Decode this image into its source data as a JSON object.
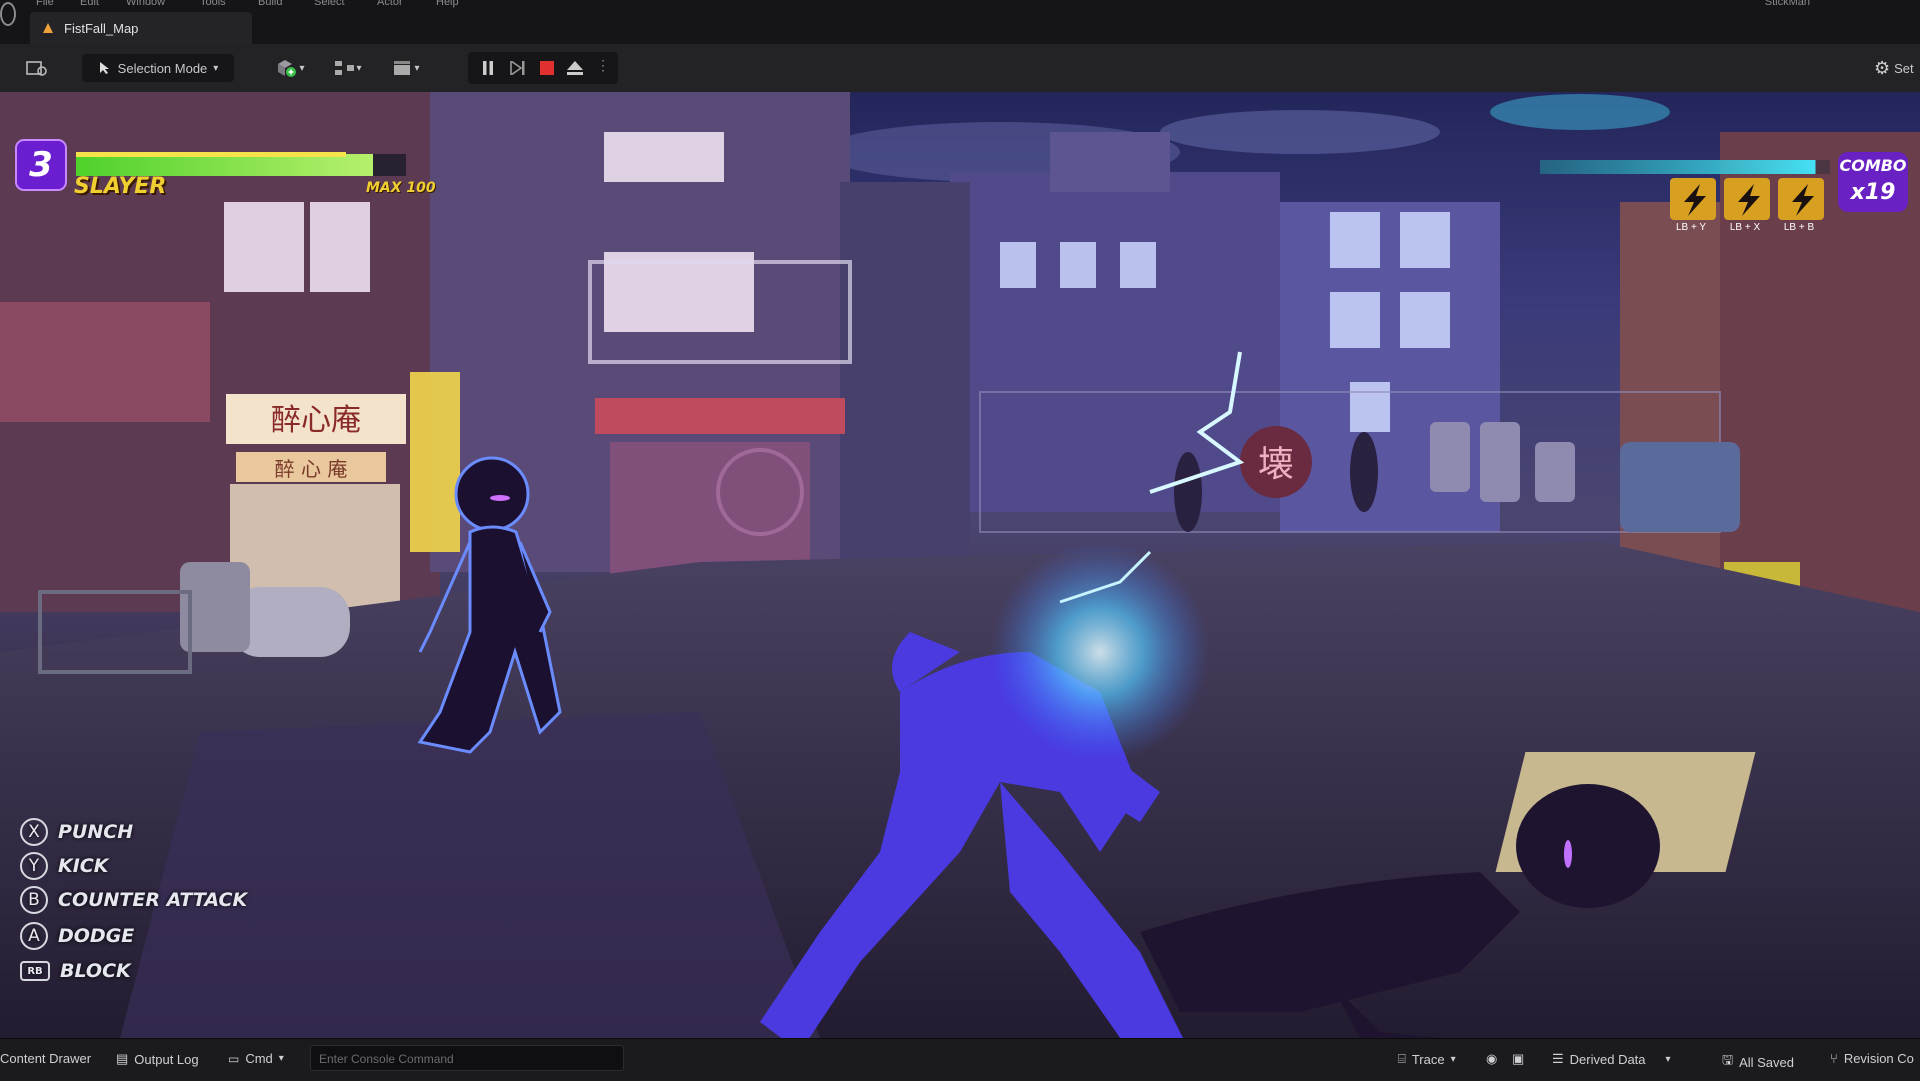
{
  "menubar": {
    "items": [
      "File",
      "Edit",
      "Window",
      "Tools",
      "Build",
      "Select",
      "Actor",
      "Help"
    ],
    "user": "StickMan"
  },
  "tab": {
    "label": "FistFall_Map",
    "icon": "level-icon"
  },
  "toolbar": {
    "selection_mode": "Selection Mode",
    "settings_label": "Set"
  },
  "hud": {
    "player_level": "3",
    "player_name": "SLAYER",
    "max_label": "MAX 100",
    "player_health": 0.9,
    "enemy_health": 0.95,
    "combo_label": "COMBO",
    "combo_count": "x19",
    "controls": [
      {
        "key": "X",
        "action": "PUNCH"
      },
      {
        "key": "Y",
        "action": "KICK"
      },
      {
        "key": "B",
        "action": "COUNTER ATTACK"
      },
      {
        "key": "A",
        "action": "DODGE"
      },
      {
        "key": "RB",
        "action": "BLOCK"
      }
    ],
    "special_combos": [
      "LB + Y",
      "LB + X",
      "LB + B"
    ],
    "shop_sign": "醉心庵",
    "shop_sign_small": "醉 心 庵",
    "shutter_sign": "壊",
    "colors": {
      "health": "#7be03c",
      "enemy_health": "#36c6e8",
      "accent": "#7a28d8"
    }
  },
  "statusbar": {
    "content_drawer": "Content Drawer",
    "output_log": "Output Log",
    "cmd": "Cmd",
    "console_placeholder": "Enter Console Command",
    "trace": "Trace",
    "derived_data": "Derived Data",
    "all_saved": "All Saved",
    "revision": "Revision Co"
  }
}
